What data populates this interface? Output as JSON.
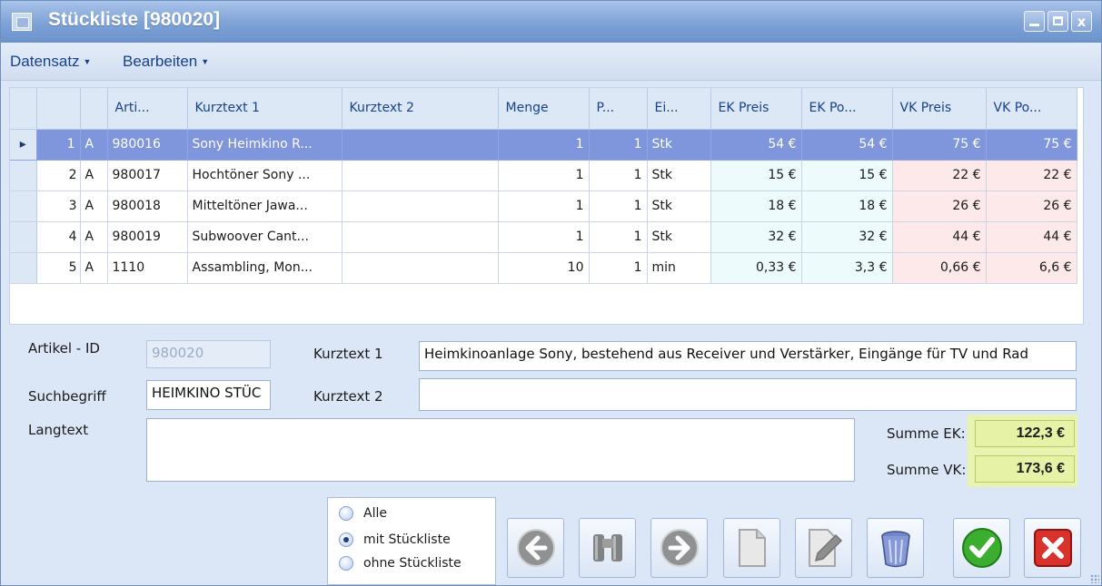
{
  "window": {
    "title": "Stückliste [980020]",
    "close_glyph": "x"
  },
  "menu": [
    {
      "label": "Datensatz"
    },
    {
      "label": "Bearbeiten"
    }
  ],
  "grid": {
    "columns": [
      "Arti...",
      "Kurztext 1",
      "Kurztext 2",
      "Menge",
      "P...",
      "Ei...",
      "EK Preis",
      "EK Po...",
      "VK Preis",
      "VK Po..."
    ],
    "rows": [
      {
        "nr": "1",
        "typ": "A",
        "artikel": "980016",
        "kurztext1": "Sony Heimkino R...",
        "kurztext2": "",
        "menge": "1",
        "p": "1",
        "einheit": "Stk",
        "ek_preis": "54 €",
        "ek_pos": "54 €",
        "vk_preis": "75 €",
        "vk_pos": "75 €",
        "selected": true
      },
      {
        "nr": "2",
        "typ": "A",
        "artikel": "980017",
        "kurztext1": "Hochtöner Sony ...",
        "kurztext2": "",
        "menge": "1",
        "p": "1",
        "einheit": "Stk",
        "ek_preis": "15 €",
        "ek_pos": "15 €",
        "vk_preis": "22 €",
        "vk_pos": "22 €"
      },
      {
        "nr": "3",
        "typ": "A",
        "artikel": "980018",
        "kurztext1": "Mitteltöner Jawa...",
        "kurztext2": "",
        "menge": "1",
        "p": "1",
        "einheit": "Stk",
        "ek_preis": "18 €",
        "ek_pos": "18 €",
        "vk_preis": "26 €",
        "vk_pos": "26 €"
      },
      {
        "nr": "4",
        "typ": "A",
        "artikel": "980019",
        "kurztext1": "Subwoover Cant...",
        "kurztext2": "",
        "menge": "1",
        "p": "1",
        "einheit": "Stk",
        "ek_preis": "32 €",
        "ek_pos": "32 €",
        "vk_preis": "44 €",
        "vk_pos": "44 €"
      },
      {
        "nr": "5",
        "typ": "A",
        "artikel": "1110",
        "kurztext1": "Assambling, Mon...",
        "kurztext2": "",
        "menge": "10",
        "p": "1",
        "einheit": "min",
        "ek_preis": "0,33 €",
        "ek_pos": "3,3 €",
        "vk_preis": "0,66 €",
        "vk_pos": "6,6 €"
      }
    ]
  },
  "form": {
    "artikel_id_label": "Artikel - ID",
    "artikel_id_value": "980020",
    "suchbegriff_label": "Suchbegriff",
    "suchbegriff_value": "HEIMKINO STÜC",
    "kurztext1_label": "Kurztext 1",
    "kurztext1_value": "Heimkinoanlage Sony, bestehend aus Receiver und Verstärker, Eingänge für TV und Rad",
    "kurztext2_label": "Kurztext 2",
    "kurztext2_value": "",
    "langtext_label": "Langtext",
    "langtext_value": "",
    "summe_ek_label": "Summe EK:",
    "summe_ek_value": "122,3 €",
    "summe_vk_label": "Summe VK:",
    "summe_vk_value": "173,6 €"
  },
  "filter": {
    "options": [
      {
        "label": "Alle",
        "checked": false
      },
      {
        "label": "mit Stückliste",
        "checked": true
      },
      {
        "label": "ohne Stückliste",
        "checked": false
      }
    ]
  },
  "toolbar": {
    "buttons": [
      {
        "icon": "arrow-left-icon",
        "enabled": false
      },
      {
        "icon": "binoculars-icon",
        "enabled": false
      },
      {
        "icon": "arrow-right-icon",
        "enabled": false
      },
      {
        "icon": "new-document-icon",
        "enabled": false
      },
      {
        "icon": "edit-pencil-icon",
        "enabled": false
      },
      {
        "icon": "trash-icon",
        "enabled": true
      },
      {
        "icon": "confirm-check-icon",
        "enabled": true
      },
      {
        "icon": "cancel-x-icon",
        "enabled": true
      }
    ]
  },
  "colors": {
    "selected_row": "#7f95dc",
    "ek_cell": "#eefbfc",
    "vk_cell": "#fde9ea",
    "sum_highlight": "#e6f2a6",
    "title_gradient": "#7ea2d6",
    "confirm_green": "#3cae2f",
    "cancel_red": "#d9322c"
  }
}
